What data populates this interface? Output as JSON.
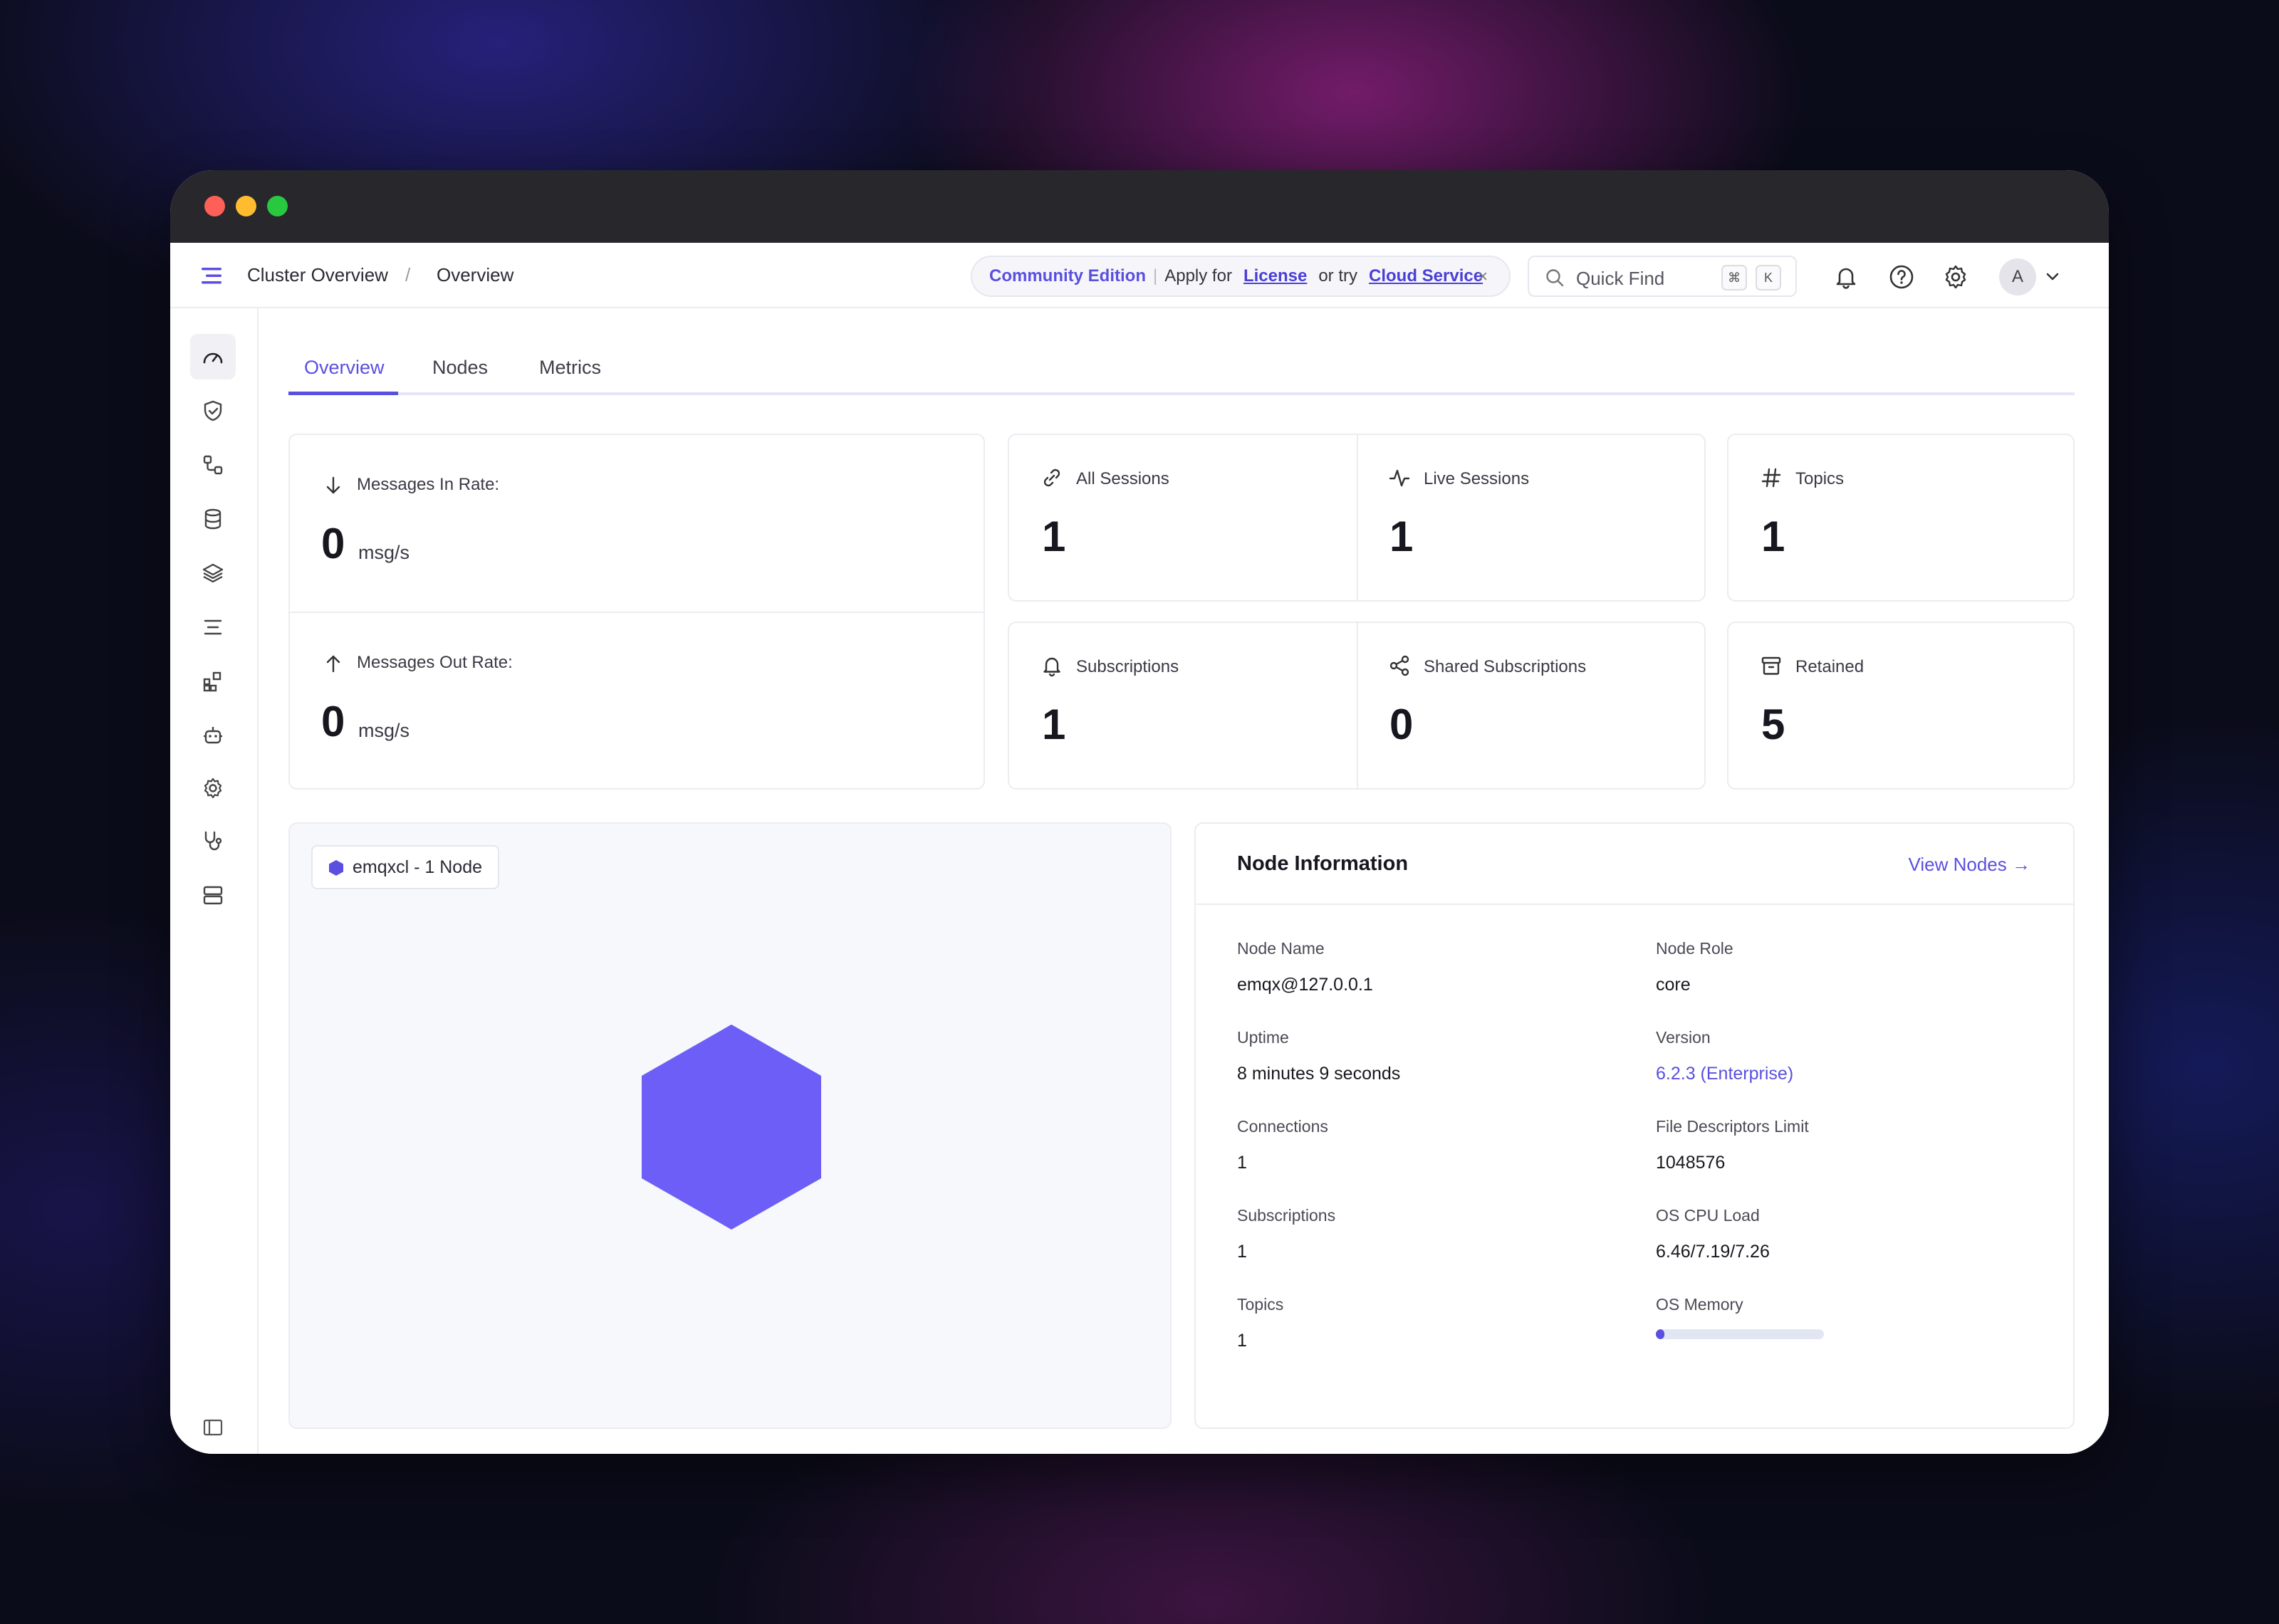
{
  "breadcrumb": {
    "first": "Cluster Overview",
    "separator": "/",
    "current": "Overview"
  },
  "banner": {
    "edition": "Community Edition",
    "divider": "|",
    "apply_for": "Apply for",
    "license": "License",
    "or_try": "or try",
    "cloud_service": "Cloud Service",
    "close": "×"
  },
  "search": {
    "placeholder": "Quick Find",
    "key1": "⌘",
    "key2": "K"
  },
  "user": {
    "avatar_initial": "A"
  },
  "tabs": [
    {
      "label": "Overview",
      "active": true
    },
    {
      "label": "Nodes",
      "active": false
    },
    {
      "label": "Metrics",
      "active": false
    }
  ],
  "rates": {
    "in": {
      "label": "Messages In Rate:",
      "value": "0",
      "unit": "msg/s"
    },
    "out": {
      "label": "Messages Out Rate:",
      "value": "0",
      "unit": "msg/s"
    }
  },
  "stats": {
    "all_sessions": {
      "label": "All Sessions",
      "value": "1"
    },
    "live_sessions": {
      "label": "Live Sessions",
      "value": "1"
    },
    "topics": {
      "label": "Topics",
      "value": "1"
    },
    "subscriptions": {
      "label": "Subscriptions",
      "value": "1"
    },
    "shared_subscriptions": {
      "label": "Shared Subscriptions",
      "value": "0"
    },
    "retained": {
      "label": "Retained",
      "value": "5"
    }
  },
  "topology": {
    "chip_label": "emqxcl - 1 Node"
  },
  "node_info": {
    "title": "Node Information",
    "view_nodes": "View Nodes →",
    "node_name": {
      "label": "Node Name",
      "value": "emqx@127.0.0.1"
    },
    "node_role": {
      "label": "Node Role",
      "value": "core"
    },
    "uptime": {
      "label": "Uptime",
      "value": "8 minutes 9 seconds"
    },
    "version": {
      "label": "Version",
      "value": "6.2.3 (Enterprise)"
    },
    "connections": {
      "label": "Connections",
      "value": "1"
    },
    "fd_limit": {
      "label": "File Descriptors Limit",
      "value": "1048576"
    },
    "subscriptions": {
      "label": "Subscriptions",
      "value": "1"
    },
    "cpu_load": {
      "label": "OS CPU Load",
      "value": "6.46/7.19/7.26"
    },
    "topics": {
      "label": "Topics",
      "value": "1"
    },
    "os_memory": {
      "label": "OS Memory",
      "fraction": 0.05
    }
  },
  "colors": {
    "accent": "#5a4fe0",
    "node": "#6c5ef7"
  }
}
